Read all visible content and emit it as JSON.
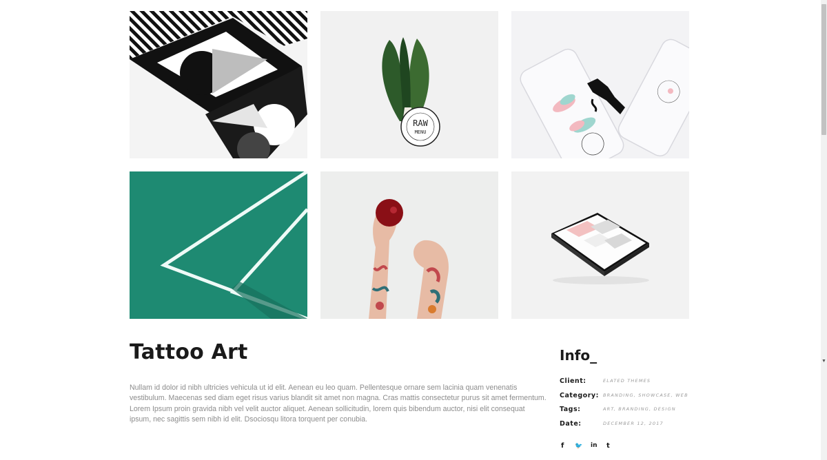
{
  "gallery": {
    "items": [
      {
        "alt": "geometric black and white print"
      },
      {
        "alt": "raw menu chard"
      },
      {
        "alt": "phone mockups"
      },
      {
        "alt": "green court lines"
      },
      {
        "alt": "tattooed hands with apple"
      },
      {
        "alt": "tablet mockup"
      }
    ],
    "raw_menu_top": "RAW",
    "raw_menu_bottom": "MENU"
  },
  "project": {
    "title": "Tattoo Art",
    "description": "Nullam id dolor id nibh ultricies vehicula ut id elit. Aenean eu leo quam. Pellentesque ornare sem lacinia quam venenatis vestibulum. Maecenas sed diam eget risus varius blandit sit amet non magna. Cras mattis consectetur purus sit amet fermentum. Lorem Ipsum proin gravida nibh vel velit auctor aliquet. Aenean sollicitudin, lorem quis bibendum auctor, nisi elit consequat ipsum, nec sagittis sem nibh id elit. Dsociosqu litora torquent per conubia."
  },
  "info": {
    "title": "Info_",
    "rows": [
      {
        "label": "Client:",
        "value": "Elated Themes"
      },
      {
        "label": "Category:",
        "value": "Branding, Showcase, Web"
      },
      {
        "label": "Tags:",
        "value": "Art, Branding, Design"
      },
      {
        "label": "Date:",
        "value": "December 12, 2017"
      }
    ]
  },
  "social": [
    {
      "icon": "facebook-icon",
      "glyph": "f"
    },
    {
      "icon": "twitter-icon",
      "glyph": "🐦"
    },
    {
      "icon": "linkedin-icon",
      "glyph": "in"
    },
    {
      "icon": "tumblr-icon",
      "glyph": "t"
    }
  ],
  "colors": {
    "accent_green": "#1e8a72",
    "text_dark": "#1a1a1a",
    "text_muted": "#8c8c8c"
  }
}
